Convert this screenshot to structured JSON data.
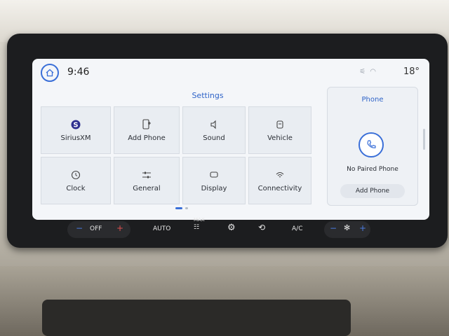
{
  "status_bar": {
    "time": "9:46",
    "temperature": "18°",
    "icons": [
      "no-signal-icon",
      "wifi-icon"
    ]
  },
  "settings": {
    "title": "Settings",
    "tiles": [
      {
        "label": "SiriusXM",
        "icon": "siriusxm-icon"
      },
      {
        "label": "Add Phone",
        "icon": "add-phone-icon"
      },
      {
        "label": "Sound",
        "icon": "speaker-icon"
      },
      {
        "label": "Vehicle",
        "icon": "vehicle-icon"
      },
      {
        "label": "Clock",
        "icon": "clock-icon"
      },
      {
        "label": "General",
        "icon": "sliders-icon"
      },
      {
        "label": "Display",
        "icon": "display-icon"
      },
      {
        "label": "Connectivity",
        "icon": "wifi-icon"
      }
    ]
  },
  "phone_panel": {
    "title": "Phone",
    "status": "No Paired Phone",
    "add_button": "Add Phone"
  },
  "hvac": {
    "fan": "OFF",
    "auto": "AUTO",
    "max": "MAX",
    "ac": "A/C"
  },
  "colors": {
    "accent": "#3a6fd8",
    "screen_bg": "#f4f6f9",
    "tile_bg": "#e9edf2"
  }
}
